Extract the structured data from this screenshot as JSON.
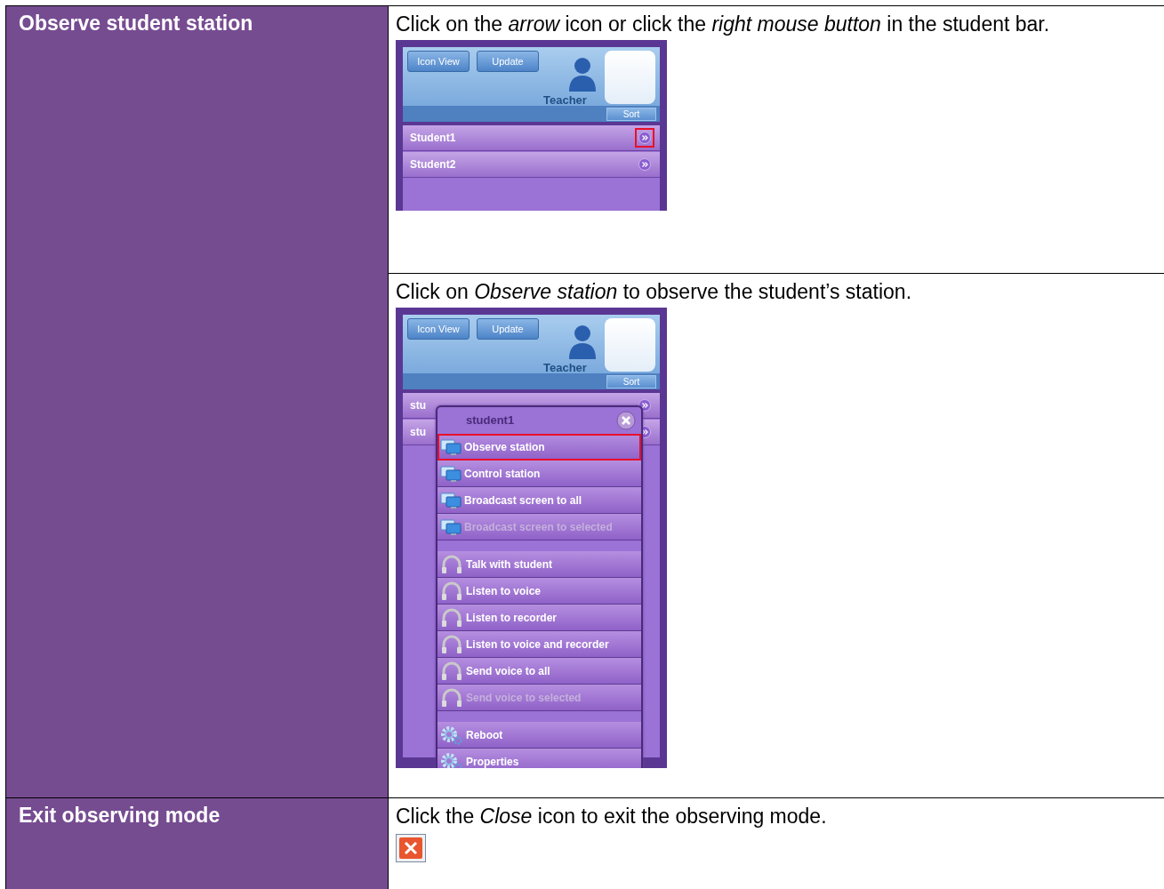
{
  "rows": [
    {
      "heading": "Observe student station",
      "steps": [
        {
          "instruction": "Click on the *arrow* icon or click the *right mouse button* in the student bar.",
          "kind": "screenshot",
          "screenshot": {
            "toolbar_buttons": [
              "Icon View",
              "Update"
            ],
            "teacher_label": "Teacher",
            "sort_button": "Sort",
            "students": [
              {
                "name": "Student1",
                "highlighted": true
              },
              {
                "name": "Student2",
                "highlighted": false
              }
            ]
          }
        },
        {
          "instruction": "Click on *Observe station* to observe the student’s station.",
          "kind": "screenshot",
          "screenshot": {
            "toolbar_buttons": [
              "Icon View",
              "Update"
            ],
            "teacher_label": "Teacher",
            "sort_button": "Sort",
            "students": [
              {
                "name": "stu",
                "highlighted": false
              },
              {
                "name": "stu",
                "highlighted": false
              }
            ],
            "context_menu": {
              "title": "student1",
              "groups": [
                [
                  {
                    "label": "Observe station",
                    "kind": "monitor",
                    "disabled": false,
                    "highlighted": true
                  },
                  {
                    "label": "Control station",
                    "kind": "monitor",
                    "disabled": false,
                    "highlighted": false
                  },
                  {
                    "label": "Broadcast screen to all",
                    "kind": "monitor",
                    "disabled": false,
                    "highlighted": false
                  },
                  {
                    "label": "Broadcast screen to selected",
                    "kind": "monitor",
                    "disabled": true,
                    "highlighted": false
                  }
                ],
                [
                  {
                    "label": "Talk with student",
                    "kind": "headset",
                    "disabled": false,
                    "highlighted": false
                  },
                  {
                    "label": "Listen to voice",
                    "kind": "headset",
                    "disabled": false,
                    "highlighted": false
                  },
                  {
                    "label": "Listen to recorder",
                    "kind": "headset",
                    "disabled": false,
                    "highlighted": false
                  },
                  {
                    "label": "Listen to voice and recorder",
                    "kind": "headset",
                    "disabled": false,
                    "highlighted": false
                  },
                  {
                    "label": "Send voice to all",
                    "kind": "headset",
                    "disabled": false,
                    "highlighted": false
                  },
                  {
                    "label": "Send voice to selected",
                    "kind": "headset",
                    "disabled": true,
                    "highlighted": false
                  }
                ],
                [
                  {
                    "label": "Reboot",
                    "kind": "gear",
                    "disabled": false,
                    "highlighted": false
                  },
                  {
                    "label": "Properties",
                    "kind": "gear",
                    "disabled": false,
                    "highlighted": false
                  }
                ]
              ]
            }
          }
        }
      ]
    },
    {
      "heading": "Exit observing mode",
      "steps": [
        {
          "instruction": "Click the *Close* icon to exit the observing mode.",
          "kind": "close_icon"
        }
      ]
    }
  ]
}
